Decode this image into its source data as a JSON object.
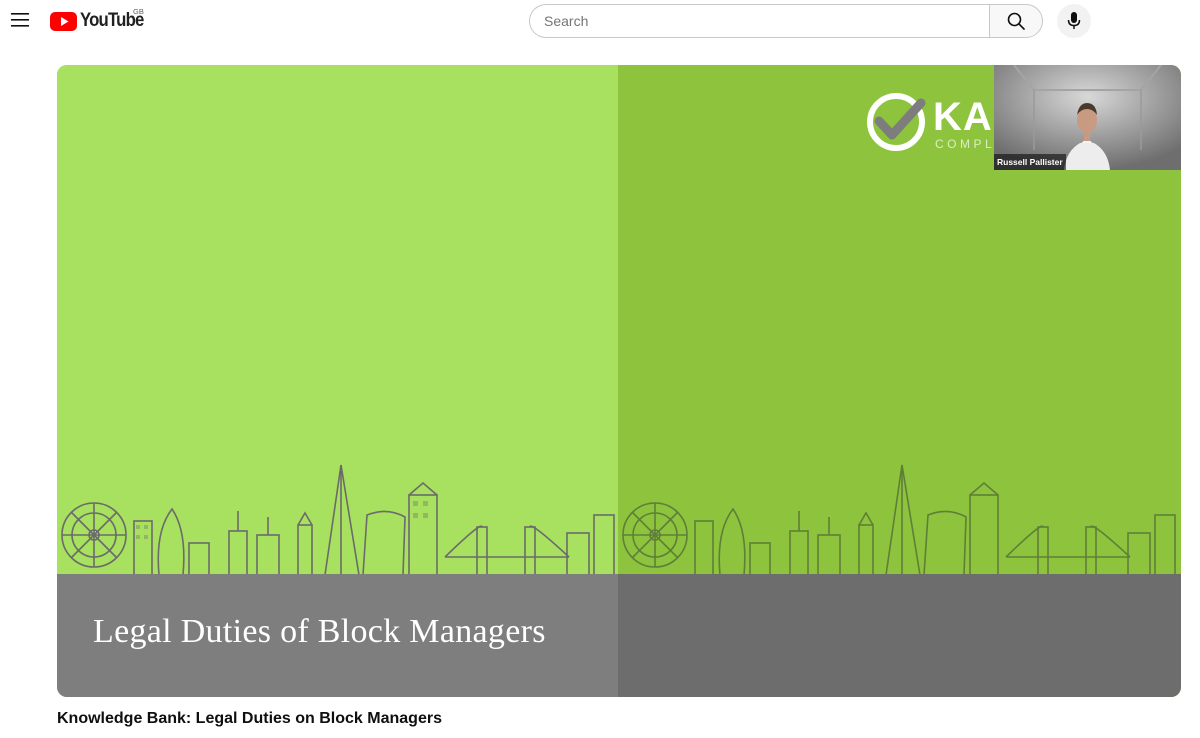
{
  "masthead": {
    "logo_text": "YouTube",
    "country_code": "GB",
    "search_placeholder": "Search",
    "search_value": "",
    "icons": {
      "menu": "hamburger-menu-icon",
      "logo": "youtube-play-icon",
      "search": "search-icon",
      "voice": "microphone-icon"
    },
    "colors": {
      "brand_red": "#ff0000"
    }
  },
  "player": {
    "slide": {
      "title": "Legal Duties of Block Managers",
      "brand_text": "KA",
      "brand_subtext": "COMPL",
      "colors": {
        "green_light": "#a8e05f",
        "green_dark": "#8dc33d",
        "band_gray": "#7e7e7e"
      }
    },
    "participant": {
      "name": "Russell Pallister"
    }
  },
  "video": {
    "title": "Knowledge Bank: Legal Duties on Block Managers"
  }
}
